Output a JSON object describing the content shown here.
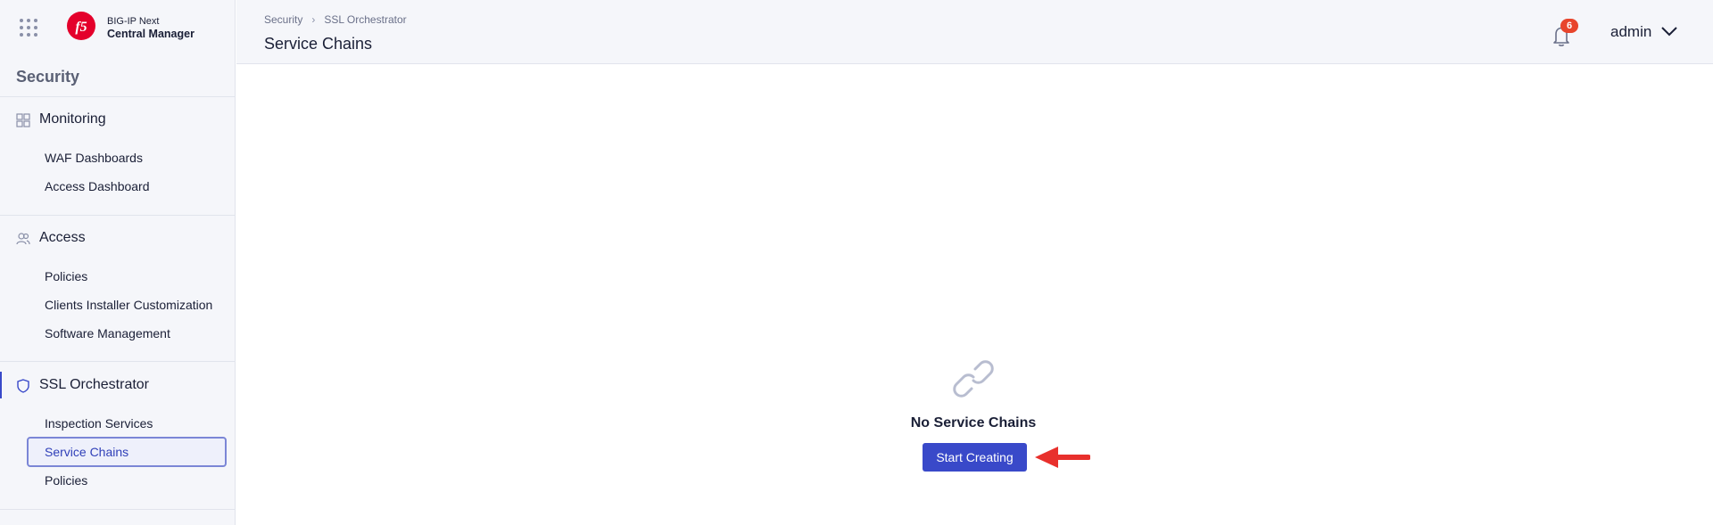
{
  "brand": {
    "line1": "BIG-IP Next",
    "line2": "Central Manager",
    "logo_icon": "f5-logo",
    "logo_color": "#e4002b"
  },
  "sidebar": {
    "title": "Security",
    "groups": [
      {
        "label": "Monitoring",
        "icon": "dashboard-grid-icon",
        "items": [
          {
            "label": "WAF Dashboards"
          },
          {
            "label": "Access Dashboard"
          }
        ]
      },
      {
        "label": "Access",
        "icon": "users-icon",
        "items": [
          {
            "label": "Policies"
          },
          {
            "label": "Clients Installer Customization"
          },
          {
            "label": "Software Management"
          }
        ]
      },
      {
        "label": "SSL Orchestrator",
        "icon": "shield-icon",
        "active": true,
        "items": [
          {
            "label": "Inspection Services"
          },
          {
            "label": "Service Chains",
            "selected": true
          },
          {
            "label": "Policies"
          }
        ]
      }
    ]
  },
  "header": {
    "breadcrumb": [
      "Security",
      "SSL Orchestrator"
    ],
    "title": "Service Chains",
    "notifications_count": "6",
    "user": "admin"
  },
  "empty_state": {
    "icon": "link-icon",
    "title": "No Service Chains",
    "button_label": "Start Creating"
  },
  "colors": {
    "accent": "#3949c9",
    "badge": "#e8452c",
    "annotation_arrow": "#e8302c"
  }
}
